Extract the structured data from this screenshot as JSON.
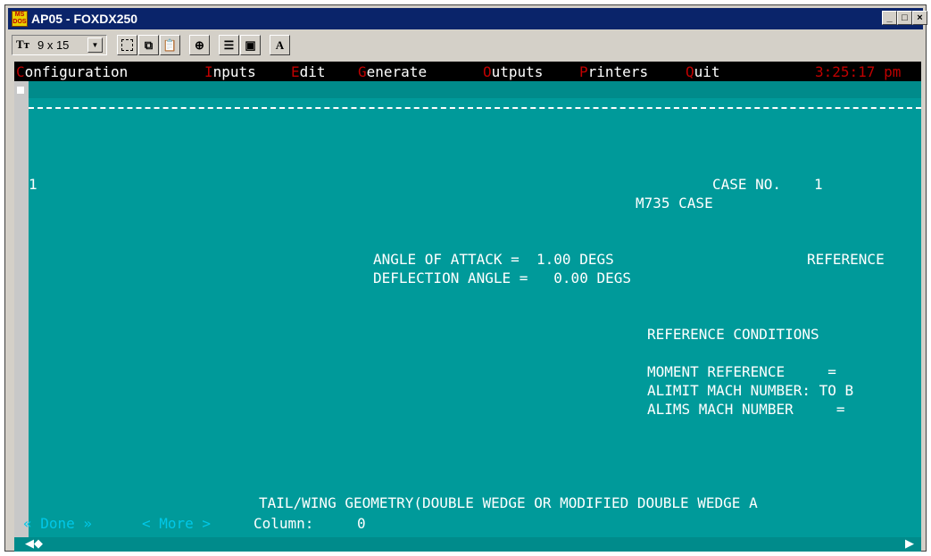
{
  "window": {
    "title": "AP05 - FOXDX250",
    "icon": "ms-dos-icon",
    "controls": [
      "minimize",
      "maximize",
      "close"
    ]
  },
  "toolbar": {
    "font_size": "9 x 15",
    "buttons": [
      "mark-icon",
      "copy-icon",
      "paste-icon",
      "fullscreen-icon",
      "properties-icon",
      "background-icon",
      "font-icon"
    ],
    "font_button_label": "A"
  },
  "menubar": {
    "items": [
      {
        "hotkey": "C",
        "rest": "onfiguration"
      },
      {
        "hotkey": "I",
        "rest": "nputs"
      },
      {
        "hotkey": "E",
        "rest": "dit"
      },
      {
        "hotkey": "G",
        "rest": "enerate"
      },
      {
        "hotkey": "O",
        "rest": "utputs"
      },
      {
        "hotkey": "P",
        "rest": "rinters"
      },
      {
        "hotkey": "Q",
        "rest": "uit"
      }
    ],
    "clock": "3:25:17 pm"
  },
  "document": {
    "dashes": "--------------------------------------------------------------------------------------------",
    "page_marker": "1",
    "case_no_label": "CASE NO.",
    "case_no_value": "1",
    "case_name": "M735 CASE",
    "angle_of_attack": "ANGLE OF ATTACK =  1.00 DEGS",
    "reference_cut": "REFERENCE",
    "deflection_angle": "DEFLECTION ANGLE =   0.00 DEGS",
    "reference_conditions": "REFERENCE CONDITIONS",
    "moment_reference": "MOMENT REFERENCE     =",
    "alimit_mach": "ALIMIT MACH NUMBER: TO B",
    "alims_mach": "ALIMS MACH NUMBER     =",
    "tail_wing": "TAIL/WING GEOMETRY(DOUBLE WEDGE OR MODIFIED DOUBLE WEDGE A"
  },
  "status": {
    "done": "« Done »",
    "more": "< More >",
    "column_label": "Column:",
    "column_value": "0"
  },
  "colors": {
    "console_bg": "#009a9a",
    "hotkey": "#c00000",
    "title_bar": "#0a246a"
  }
}
